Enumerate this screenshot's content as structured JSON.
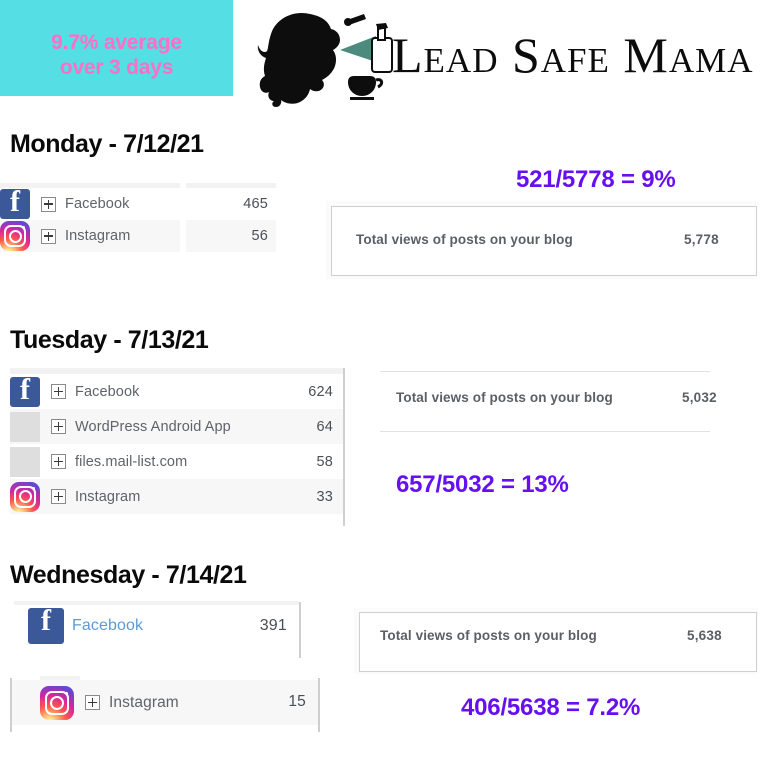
{
  "header": {
    "banner_line1": "9.7% average",
    "banner_line2": "over 3 days",
    "banner_bg": "#55DEE3",
    "banner_text_color": "#FF6EC7",
    "logo_text": "Lead Safe Mama",
    "logo_icon": "woman-silhouette-with-spray-bottle-logo"
  },
  "accent": {
    "purple": "#6610F2",
    "facebook_blue": "#3b5998",
    "link_blue": "#5b9bd5"
  },
  "days": [
    {
      "heading": "Monday - 7/12/21",
      "referrers": [
        {
          "icon": "facebook-icon",
          "expander": "plus-box",
          "name": "Facebook",
          "views": "465"
        },
        {
          "icon": "instagram-icon",
          "expander": "plus-box",
          "name": "Instagram",
          "views": "56"
        }
      ],
      "total_views": {
        "label": "Total views of posts on your blog",
        "value": "5,778"
      },
      "ratio": "521/5778 = 9%"
    },
    {
      "heading": "Tuesday - 7/13/21",
      "referrers": [
        {
          "icon": "facebook-icon",
          "expander": "plus-box",
          "name": "Facebook",
          "views": "624"
        },
        {
          "icon": "blank-icon",
          "expander": "plus-box",
          "name": "WordPress Android App",
          "views": "64"
        },
        {
          "icon": "blank-icon",
          "expander": "plus-box",
          "name": "files.mail-list.com",
          "views": "58"
        },
        {
          "icon": "instagram-icon",
          "expander": "plus-box",
          "name": "Instagram",
          "views": "33"
        }
      ],
      "total_views": {
        "label": "Total views of posts on your blog",
        "value": "5,032"
      },
      "ratio": "657/5032 = 13%"
    },
    {
      "heading": "Wednesday - 7/14/21",
      "referrers": [
        {
          "icon": "facebook-icon",
          "expander": "none",
          "name": "Facebook",
          "views": "391"
        },
        {
          "icon": "instagram-icon",
          "expander": "plus-box",
          "name": "Instagram",
          "views": "15"
        }
      ],
      "total_views": {
        "label": "Total views of posts on your blog",
        "value": "5,638"
      },
      "ratio": "406/5638 = 7.2%"
    }
  ]
}
